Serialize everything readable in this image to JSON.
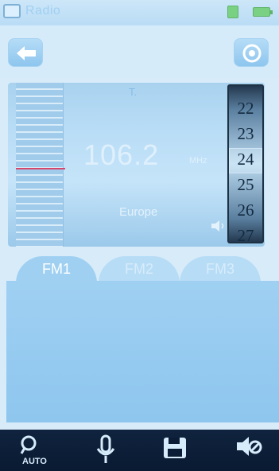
{
  "status_bar": {
    "title": "Radio",
    "icons": [
      "app-icon",
      "sim-icon",
      "battery-icon"
    ]
  },
  "toolbar": {
    "back_icon": "left-arrow-icon",
    "settings_icon": "target-icon"
  },
  "tuner": {
    "antenna_label": "T.",
    "frequency": "106.2",
    "unit": "MHz",
    "region": "Europe",
    "channels": [
      "22",
      "23",
      "24",
      "25",
      "26",
      "27"
    ],
    "selected_channel": "24"
  },
  "tabs": [
    "FM1",
    "FM2",
    "FM3"
  ],
  "bottom_bar": {
    "auto_label": "AUTO",
    "icons": [
      "search-icon",
      "microphone-icon",
      "save-icon",
      "mute-icon"
    ]
  },
  "colors": {
    "background": "#d7ebf9",
    "accent": "#9fd0f2",
    "needle": "#d6456b",
    "bottom_bar": "#0b1d36"
  }
}
